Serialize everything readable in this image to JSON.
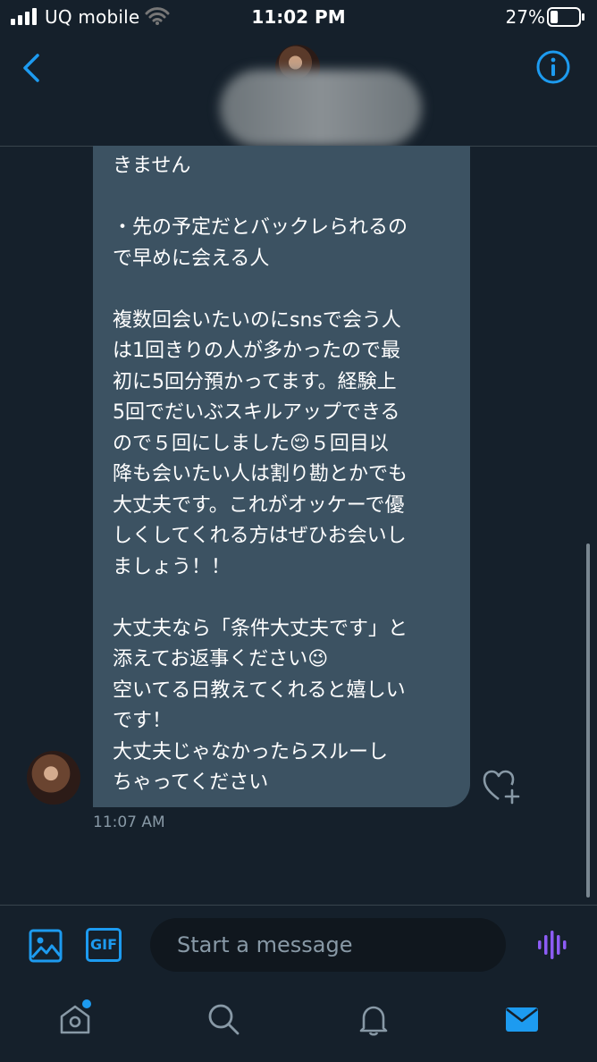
{
  "status_bar": {
    "carrier": "UQ mobile",
    "time": "11:02 PM",
    "battery_percent": "27%",
    "battery_level": 0.27
  },
  "conversation": {
    "message_lines": [
      "きません",
      "",
      "・先の予定だとバックレられるの",
      "で早めに会える人",
      "",
      "複数回会いたいのにsnsで会う人",
      "は1回きりの人が多かったので最",
      "初に5回分預かってます。経験上",
      "5回でだいぶスキルアップできる",
      "ので５回にしました😌５回目以",
      "降も会いたい人は割り勘とかでも",
      "大丈夫です。これがオッケーで優",
      "しくしてくれる方はぜひお会いし",
      "ましょう！！",
      "",
      "大丈夫なら「条件大丈夫です」と",
      "添えてお返事ください😉",
      "空いてる日教えてくれると嬉しい",
      "です！",
      "大丈夫じゃなかったらスルーし",
      "ちゃってください"
    ],
    "timestamp": "11:07 AM"
  },
  "composer": {
    "gif_label": "GIF",
    "placeholder": "Start a message"
  },
  "colors": {
    "background": "#15202b",
    "bubble": "#3c5262",
    "accent": "#1d9bf0",
    "voice": "#8c5cf5",
    "muted": "#8899a6"
  },
  "icons": [
    "signal-icon",
    "wifi-icon",
    "battery-icon",
    "back-chevron-icon",
    "info-icon",
    "like-heart-icon",
    "image-icon",
    "gif-icon",
    "voice-icon",
    "home-icon",
    "search-icon",
    "notifications-icon",
    "messages-icon"
  ]
}
